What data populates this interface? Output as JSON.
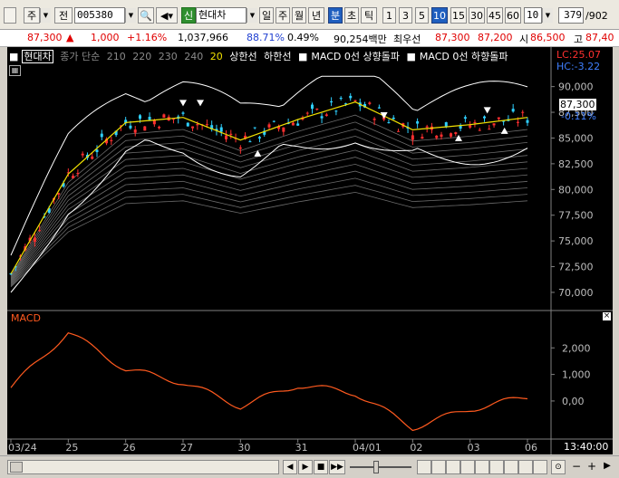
{
  "toolbar": {
    "market": "주",
    "prev": "전",
    "code": "005380",
    "search_icon": "search-icon",
    "sound_icon": "speaker-icon",
    "badge": "신",
    "stock_name": "현대차",
    "periods": [
      "일",
      "주",
      "월",
      "년"
    ],
    "minute_tabs": [
      "분",
      "초",
      "틱"
    ],
    "minutes": [
      "1",
      "3",
      "5",
      "10",
      "15",
      "30",
      "45",
      "60"
    ],
    "active_period": "분",
    "active_minute": "10",
    "interval_value": "10",
    "count_value": "379",
    "count_total": "/902"
  },
  "quote": {
    "price": "87,300",
    "change_arrow": "▲",
    "change": "1,000",
    "change_pct": "+1.16%",
    "volume": "1,037,966",
    "vol_ratio": "88.71%",
    "turnover": "0.49%",
    "amount": "90,254백만",
    "best_label": "최우선",
    "ask": "87,300",
    "bid": "87,200",
    "open_label": "시",
    "open": "86,500",
    "high_label": "고",
    "high": "87,40"
  },
  "legend": {
    "name": "현대차",
    "items": [
      "종가 단순",
      "210",
      "220",
      "230",
      "240"
    ],
    "ma20": "20",
    "upper": "상한선",
    "lower": "하한선",
    "macd_up_prefix": "■",
    "macd_up": "MACD 0선 상향돌파",
    "macd_down_prefix": "■",
    "macd_down": "MACD 0선 하향돌파",
    "lc": "LC:25.07",
    "hc": "HC:-3.22",
    "current_price": "87,300",
    "current_pct": "-0.11%"
  },
  "macd": {
    "label": "MACD",
    "close_mark": "×"
  },
  "chart_data": [
    {
      "type": "line",
      "title": "",
      "x": [
        "03/24",
        "25",
        "26",
        "27",
        "30",
        "31",
        "04/01",
        "02",
        "03",
        "06"
      ],
      "series": [
        {
          "name": "20",
          "values": [
            71800,
            81500,
            86500,
            87000,
            84800,
            86800,
            88500,
            85800,
            86300,
            87000
          ]
        }
      ],
      "y_ticks": [
        70000,
        72500,
        75000,
        77500,
        80000,
        82500,
        85000,
        87500,
        90000
      ],
      "ylim": [
        68500,
        91200
      ],
      "y_tick_labels": [
        "70,000",
        "72,500",
        "75,000",
        "77,500",
        "80,000",
        "82,500",
        "85,000",
        "87,500",
        "90,000"
      ]
    },
    {
      "type": "line",
      "title": "",
      "x": [
        "03/24",
        "25",
        "26",
        "27",
        "30",
        "31",
        "04/01",
        "02",
        "03",
        "06"
      ],
      "series": [
        {
          "name": "MACD",
          "values": [
            500,
            2600,
            1200,
            700,
            -200,
            600,
            300,
            -1000,
            -300,
            150
          ]
        }
      ],
      "y_ticks": [
        0,
        1000,
        2000
      ],
      "ylim": [
        -1400,
        3100
      ],
      "y_tick_labels": [
        "0,00",
        "1,000",
        "2,000"
      ]
    }
  ],
  "time": {
    "clock": "13:40:00"
  },
  "bottom": {
    "buttons": [
      "◀",
      "▶",
      "■",
      "▶▶"
    ]
  }
}
